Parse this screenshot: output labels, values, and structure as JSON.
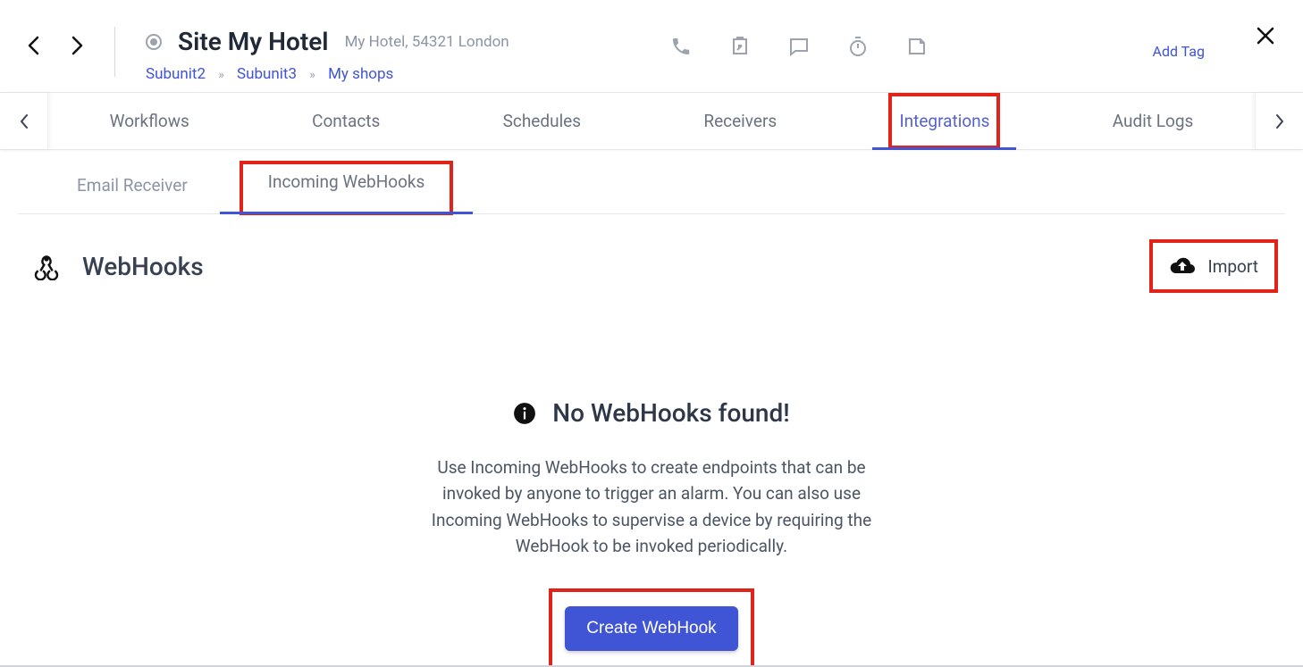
{
  "header": {
    "title": "Site My Hotel",
    "location": "My Hotel, 54321 London",
    "breadcrumb": [
      {
        "label": "Subunit2"
      },
      {
        "label": "Subunit3"
      },
      {
        "label": "My shops"
      }
    ],
    "add_tag": "Add Tag"
  },
  "tabs": {
    "items": [
      {
        "label": "Workflows"
      },
      {
        "label": "Contacts"
      },
      {
        "label": "Schedules"
      },
      {
        "label": "Receivers"
      },
      {
        "label": "Integrations"
      },
      {
        "label": "Audit Logs"
      }
    ],
    "active_index": 4
  },
  "subtabs": {
    "items": [
      {
        "label": "Email Receiver"
      },
      {
        "label": "Incoming WebHooks"
      }
    ],
    "active_index": 1
  },
  "section": {
    "title": "WebHooks",
    "import_label": "Import"
  },
  "empty": {
    "title": "No WebHooks found!",
    "desc": "Use Incoming WebHooks to create endpoints that can be invoked by anyone to trigger an alarm. You can also use Incoming WebHooks to supervise a device by requiring the WebHook to be invoked periodically.",
    "create_label": "Create WebHook"
  },
  "colors": {
    "accent": "#4054d6",
    "highlight": "#e2231a"
  }
}
